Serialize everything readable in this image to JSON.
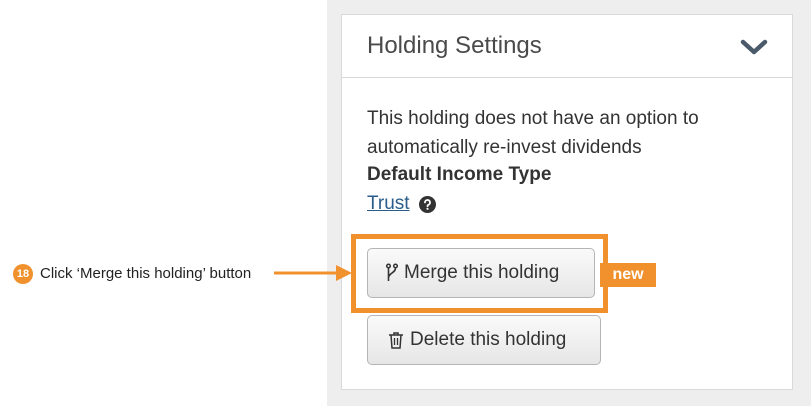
{
  "panel": {
    "title": "Holding Settings",
    "description": "This holding does not have an option to automatically re-invest dividends",
    "income_type_label": "Default Income Type",
    "income_type_value": "Trust",
    "merge_button": "Merge this holding",
    "delete_button": "Delete this holding"
  },
  "annotation": {
    "step_number": "18",
    "instruction": "Click ‘Merge this holding’ button",
    "badge": "new"
  },
  "colors": {
    "accent": "#f0912e",
    "link": "#2a5d8c"
  },
  "icons": [
    "chevron-down-icon",
    "question-circle-icon",
    "merge-branch-icon",
    "trash-icon"
  ]
}
